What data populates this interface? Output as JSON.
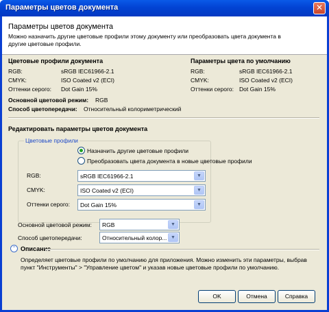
{
  "window": {
    "title": "Параметры цветов документа"
  },
  "header": {
    "title": "Параметры цветов документа",
    "description": "Можно назначить другие цветовые профили этому документу или преобразовать цвета документа в другие цветовые профили."
  },
  "document_profiles": {
    "heading": "Цветовые профили документа",
    "rows": [
      {
        "label": "RGB:",
        "value": "sRGB IEC61966-2.1"
      },
      {
        "label": "CMYK:",
        "value": "ISO Coated v2 (ECI)"
      },
      {
        "label": "Оттенки серого:",
        "value": "Dot Gain 15%"
      }
    ]
  },
  "default_params": {
    "heading": "Параметры цвета по умолчанию",
    "rows": [
      {
        "label": "RGB:",
        "value": "sRGB IEC61966-2.1"
      },
      {
        "label": "CMYK:",
        "value": "ISO Coated v2 (ECI)"
      },
      {
        "label": "Оттенки серого:",
        "value": "Dot Gain 15%"
      }
    ]
  },
  "mode": {
    "label": "Основной цветовой режим:",
    "value": "RGB"
  },
  "intent": {
    "label": "Способ цветопередачи:",
    "value": "Относительный колориметрический"
  },
  "edit": {
    "heading": "Редактировать параметры цветов документа",
    "group_title": "Цветовые профили",
    "radio_assign": "Назначить другие цветовые профили",
    "radio_convert": "Преобразовать цвета документа в новые цветовые профили",
    "selected_radio": "assign",
    "rgb_label": "RGB:",
    "rgb_value": "sRGB IEC61966-2.1",
    "cmyk_label": "CMYK:",
    "cmyk_value": "ISO Coated v2 (ECI)",
    "gray_label": "Оттенки серого:",
    "gray_value": "Dot Gain 15%",
    "mode_label": "Основной цветовой режим:",
    "mode_value": "RGB",
    "intent_label": "Способ цветопередачи:",
    "intent_value": "Относительный колор..."
  },
  "description_section": {
    "heading": "Описание",
    "text": "Определяет цветовые профили по умолчанию для приложения. Можно изменить эти параметры, выбрав пункт \"Инструменты\" > \"Управление цветом\" и указав новые цветовые профили по умолчанию."
  },
  "buttons": {
    "ok": "OK",
    "cancel": "Отмена",
    "help": "Справка"
  },
  "icons": {
    "close": "close-icon",
    "expand": "expand-collapse-icon",
    "dropdown": "chevron-down-icon"
  },
  "colors": {
    "titlebar": "#0243d3",
    "dialog_bg": "#ece9d8",
    "group_title": "#1e49c8",
    "radio_dot": "#21a121"
  }
}
